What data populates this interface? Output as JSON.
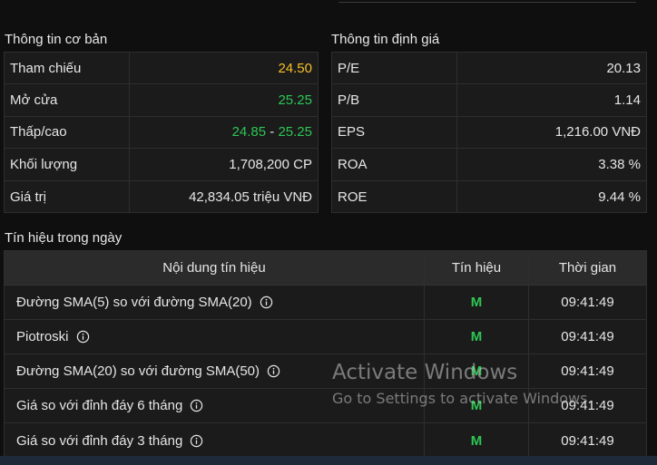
{
  "basic": {
    "title": "Thông tin cơ bản",
    "rows": [
      {
        "label": "Tham chiếu",
        "value": "24.50"
      },
      {
        "label": "Mở cửa",
        "value": "25.25"
      },
      {
        "label": "Thấp/cao",
        "low": "24.85",
        "sep": " - ",
        "high": "25.25"
      },
      {
        "label": "Khối lượng",
        "value": "1,708,200 CP"
      },
      {
        "label": "Giá trị",
        "value": "42,834.05 triệu VNĐ"
      }
    ]
  },
  "valuation": {
    "title": "Thông tin định giá",
    "rows": [
      {
        "label": "P/E",
        "value": "20.13"
      },
      {
        "label": "P/B",
        "value": "1.14"
      },
      {
        "label": "EPS",
        "value": "1,216.00 VNĐ"
      },
      {
        "label": "ROA",
        "value": "3.38 %"
      },
      {
        "label": "ROE",
        "value": "9.44 %"
      }
    ]
  },
  "signals": {
    "title": "Tín hiệu trong ngày",
    "headers": {
      "content": "Nội dung tín hiệu",
      "signal": "Tín hiệu",
      "time": "Thời gian"
    },
    "rows": [
      {
        "content": "Đường SMA(5) so với đường SMA(20)",
        "signal": "M",
        "time": "09:41:49"
      },
      {
        "content": "Piotroski",
        "signal": "M",
        "time": "09:41:49"
      },
      {
        "content": "Đường SMA(20) so với đường SMA(50)",
        "signal": "M",
        "time": "09:41:49"
      },
      {
        "content": "Giá so với đỉnh đáy 6 tháng",
        "signal": "M",
        "time": "09:41:49"
      },
      {
        "content": "Giá so với đỉnh đáy 3 tháng",
        "signal": "M",
        "time": "09:41:49"
      }
    ]
  },
  "watermark": {
    "line1": "Activate Windows",
    "line2": "Go to Settings to activate Windows."
  },
  "colors": {
    "reference": "#f5c026",
    "up": "#2dc653",
    "background": "#0f0f0f"
  }
}
